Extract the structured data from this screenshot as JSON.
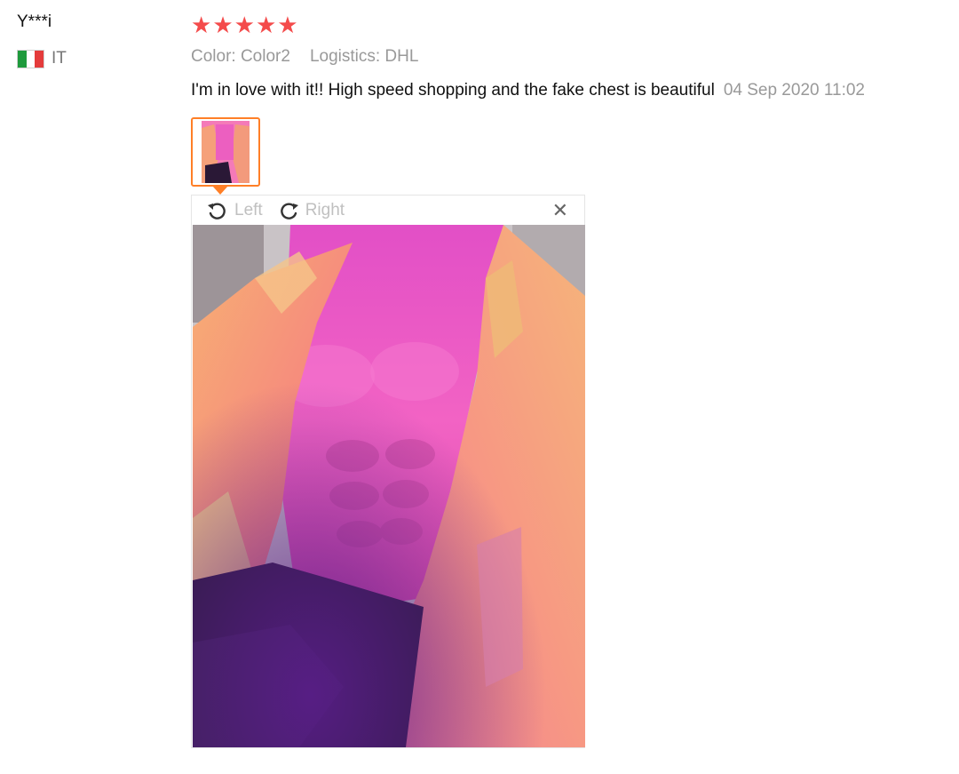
{
  "review": {
    "user": "Y***i",
    "country": "IT",
    "rating_stars": 5,
    "star_color": "#f44b4b",
    "color_label": "Color: Color2",
    "logistics_label": "Logistics: DHL",
    "text": "I'm in love with it!! High speed shopping and the fake chest is beautiful",
    "date": "04 Sep 2020 11:02"
  },
  "viewer": {
    "rotate_left_label": "Left",
    "rotate_right_label": "Right",
    "close_icon": "close-icon",
    "accent_color": "#ff7f27"
  },
  "icons": {
    "flag": "italy-flag-icon",
    "star": "star-icon",
    "rotate_left": "rotate-left-icon",
    "rotate_right": "rotate-right-icon"
  }
}
